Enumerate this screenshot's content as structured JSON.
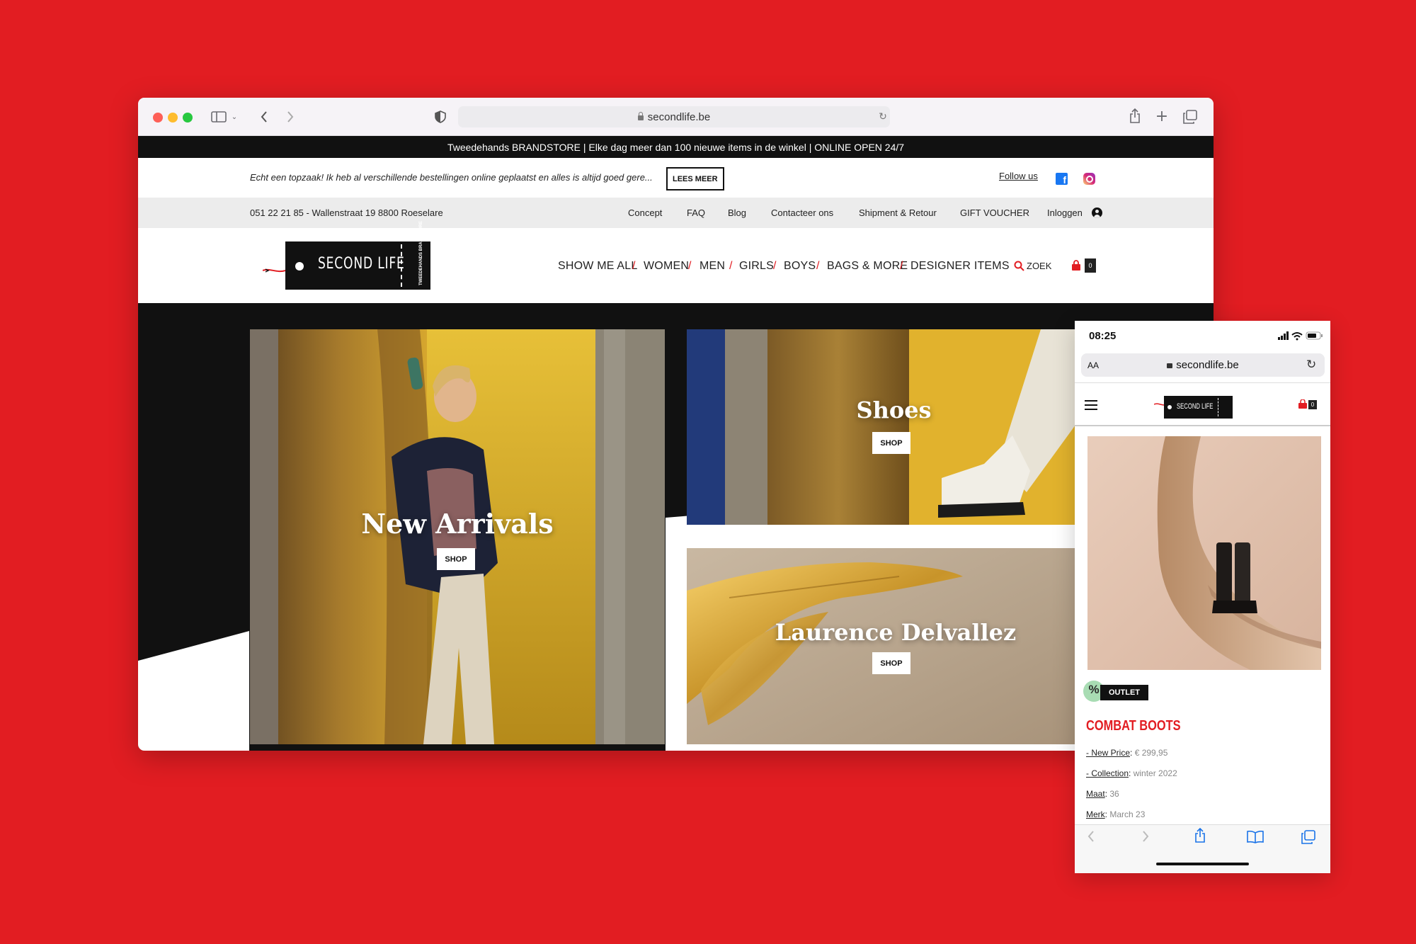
{
  "browser": {
    "url": "secondlife.be"
  },
  "site": {
    "announcement": "Tweedehands BRANDSTORE | Elke dag meer dan 100 nieuwe items in de winkel | ONLINE OPEN 24/7",
    "review_text": "Echt een topzaak! Ik heb al verschillende bestellingen online geplaatst en alles is altijd goed gere...",
    "lees_meer": "LEES MEER",
    "follow_us": "Follow us",
    "address": "051 22 21 85 - Wallenstraat 19 8800 Roeselare",
    "top_links": [
      "Concept",
      "FAQ",
      "Blog",
      "Contacteer ons",
      "Shipment & Retour",
      "GIFT VOUCHER",
      "Inloggen"
    ],
    "logo": {
      "text": "SECOND LIFE",
      "side_text": "TWEEDEHANDS BRANDSTORE"
    },
    "nav": [
      "SHOW ME ALL",
      "WOMEN",
      "MEN",
      "GIRLS",
      "BOYS",
      "BAGS & MORE",
      "DESIGNER ITEMS"
    ],
    "nav_separator": "/",
    "search_label": "ZOEK",
    "cart_count": "0",
    "tiles": [
      {
        "title": "New Arrivals",
        "button": "SHOP"
      },
      {
        "title": "Shoes",
        "button": "SHOP"
      },
      {
        "title": "Laurence Delvallez",
        "button": "SHOP"
      }
    ]
  },
  "phone": {
    "time": "08:25",
    "aa": "AA",
    "url": "secondlife.be",
    "cart_count": "0",
    "logo_text": "SECOND LIFE",
    "badge": "OUTLET",
    "product_title": "COMBAT BOOTS",
    "details": [
      {
        "label": "- New Price",
        "value": "€ 299,95"
      },
      {
        "label": "- Collection",
        "value": "winter 2022"
      },
      {
        "label": "Maat",
        "value": "36"
      },
      {
        "label": "Merk",
        "value": "March 23"
      }
    ]
  },
  "colors": {
    "accent": "#e21d22",
    "black": "#111111"
  },
  "icons": [
    "sidebar-icon",
    "back-icon",
    "forward-icon",
    "shield-icon",
    "reload-icon",
    "share-icon",
    "plus-icon",
    "tabs-icon",
    "facebook-icon",
    "instagram-icon",
    "user-icon",
    "search-icon",
    "bag-icon",
    "hamburger-icon",
    "bookmarks-icon"
  ]
}
